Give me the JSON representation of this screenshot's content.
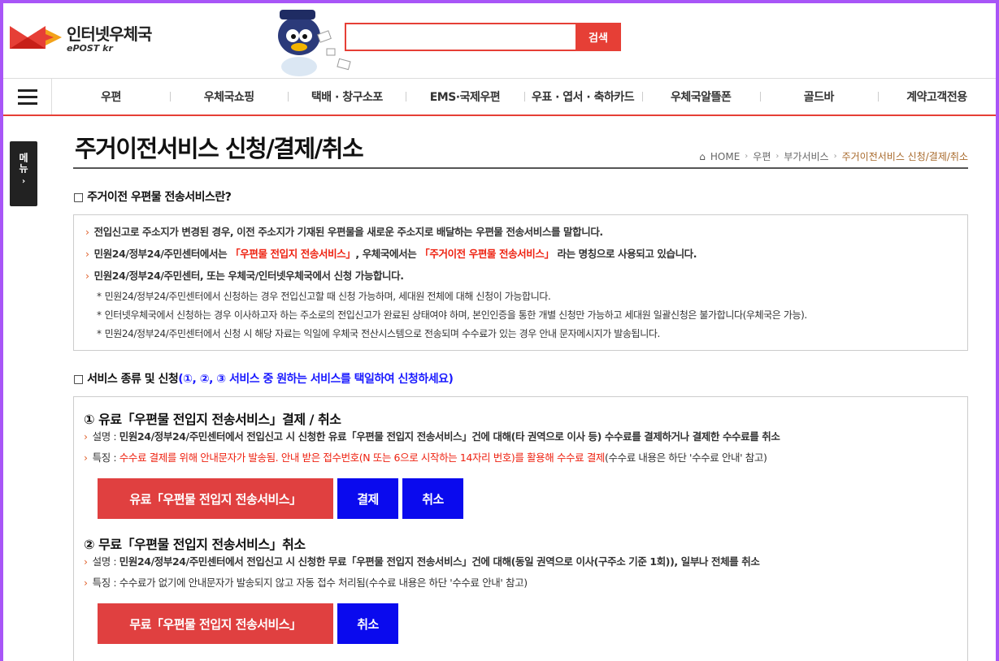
{
  "header": {
    "logo_name": "인터넷우체국",
    "logo_sub": "ePOST kr",
    "search_placeholder": "",
    "search_button": "검색"
  },
  "nav": {
    "items": [
      "우편",
      "우체국쇼핑",
      "택배 · 창구소포",
      "EMS·국제우편",
      "우표 · 엽서 · 축하카드",
      "우체국알뜰폰",
      "골드바",
      "계약고객전용"
    ]
  },
  "side_tab": {
    "label": "메뉴",
    "arrow": "›"
  },
  "page": {
    "title": "주거이전서비스 신청/결제/취소",
    "breadcrumb": [
      "HOME",
      "우편",
      "부가서비스",
      "주거이전서비스 신청/결제/취소"
    ]
  },
  "section1": {
    "title": "□ 주거이전 우편물 전송서비스란?",
    "line1": "전입신고로 주소지가 변경된 경우, 이전 주소지가 기재된 우편물을 새로운 주소지로 배달하는 우편물 전송서비스를 말합니다.",
    "line2_a": "민원24/정부24/주민센터에서는 ",
    "line2_b": "「우편물 전입지 전송서비스」",
    "line2_c": ", 우체국에서는 ",
    "line2_d": "「주거이전 우편물 전송서비스」",
    "line2_e": " 라는 명칭으로 사용되고 있습니다.",
    "line3": "민원24/정부24/주민센터, 또는 우체국/인터넷우체국에서 신청 가능합니다.",
    "sub1": "민원24/정부24/주민센터에서 신청하는 경우 전입신고할 때 신청 가능하며, 세대원 전체에 대해 신청이 가능합니다.",
    "sub2": "인터넷우체국에서 신청하는 경우 이사하고자 하는 주소로의 전입신고가 완료된 상태여야 하며, 본인인증을 통한 개별 신청만 가능하고 세대원 일괄신청은 불가합니다(우체국은 가능).",
    "sub3": "민원24/정부24/주민센터에서 신청 시 해당 자료는 익일에 우체국 전산시스템으로 전송되며 수수료가 있는 경우 안내 문자메시지가 발송됩니다."
  },
  "section2": {
    "title": "□ 서비스 종류 및 신청",
    "title_blue": "(①, ②, ③ 서비스 중 원하는 서비스를 택일하여 신청하세요)",
    "svc1": {
      "title": "① 유료「우편물 전입지 전송서비스」결제 / 취소",
      "desc_label": "설명 : ",
      "desc": "민원24/정부24/주민센터에서 전입신고 시 신청한 유료「우편물 전입지 전송서비스」건에 대해(타 권역으로 이사 등) 수수료를 결제하거나 결제한 수수료를 취소",
      "feat_label": "특징 : ",
      "feat_red": "수수료 결제를 위해 안내문자가 발송됨. 안내 받은 접수번호(N 또는 6으로 시작하는 14자리 번호)를 활용해 수수료 결제",
      "feat_rest": "(수수료 내용은 하단 '수수료 안내' 참고)",
      "btn_main": "유료「우편물 전입지 전송서비스」",
      "btn_pay": "결제",
      "btn_cancel": "취소"
    },
    "svc2": {
      "title": "② 무료「우편물 전입지 전송서비스」취소",
      "desc_label": "설명 : ",
      "desc": "민원24/정부24/주민센터에서 전입신고 시 신청한 무료「우편물 전입지 전송서비스」건에 대해(동일 권역으로 이사(구주소 기준 1회)), 일부나 전체를 취소",
      "feat_label": "특징 : ",
      "feat_rest": "수수료가 없기에 안내문자가 발송되지 않고 자동 접수 처리됨(수수료 내용은 하단 '수수료 안내' 참고)",
      "btn_main": "무료「우편물 전입지 전송서비스」",
      "btn_cancel": "취소"
    }
  },
  "colors": {
    "accent_red": "#e63f36",
    "button_blue": "#0a0aee",
    "frame": "#a855f7"
  }
}
